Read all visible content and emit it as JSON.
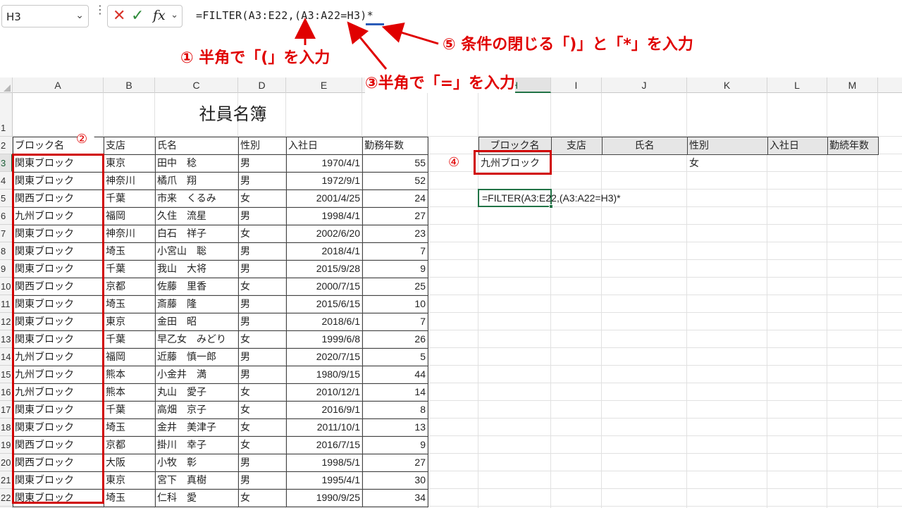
{
  "formula_bar": {
    "name_box": "H3",
    "cancel_glyph": "✕",
    "enter_glyph": "✓",
    "fx_label": "fx",
    "formula": "=FILTER(A3:E22,(A3:A22=H3)*"
  },
  "annotations": {
    "a1": "① 半角で「(」を入力",
    "a2": "②",
    "a3": "③半角で「=」を入力",
    "a4": "④",
    "a5": "⑤ 条件の閉じる「)」と「*」を入力"
  },
  "columns": [
    "A",
    "B",
    "C",
    "D",
    "E",
    "F",
    "G",
    "H",
    "I",
    "J",
    "K",
    "L",
    "M"
  ],
  "rows": [
    "1",
    "2",
    "3",
    "4",
    "5",
    "6",
    "7",
    "8",
    "9",
    "10",
    "11",
    "12",
    "13",
    "14",
    "15",
    "16",
    "17",
    "18",
    "19",
    "20",
    "21",
    "22"
  ],
  "sheet": {
    "title": "社員名簿",
    "headers": [
      "ブロック名",
      "支店",
      "氏名",
      "性別",
      "入社日",
      "勤務年数"
    ],
    "records": [
      [
        "関東ブロック",
        "東京",
        "田中　稔",
        "男",
        "1970/4/1",
        "55"
      ],
      [
        "関東ブロック",
        "神奈川",
        "橘爪　翔",
        "男",
        "1972/9/1",
        "52"
      ],
      [
        "関西ブロック",
        "千葉",
        "市来　くるみ",
        "女",
        "2001/4/25",
        "24"
      ],
      [
        "九州ブロック",
        "福岡",
        "久住　流星",
        "男",
        "1998/4/1",
        "27"
      ],
      [
        "関東ブロック",
        "神奈川",
        "白石　祥子",
        "女",
        "2002/6/20",
        "23"
      ],
      [
        "関東ブロック",
        "埼玉",
        "小宮山　聡",
        "男",
        "2018/4/1",
        "7"
      ],
      [
        "関東ブロック",
        "千葉",
        "我山　大将",
        "男",
        "2015/9/28",
        "9"
      ],
      [
        "関西ブロック",
        "京都",
        "佐藤　里香",
        "女",
        "2000/7/15",
        "25"
      ],
      [
        "関東ブロック",
        "埼玉",
        "斎藤　隆",
        "男",
        "2015/6/15",
        "10"
      ],
      [
        "関東ブロック",
        "東京",
        "金田　昭",
        "男",
        "2018/6/1",
        "7"
      ],
      [
        "関東ブロック",
        "千葉",
        "早乙女　みどり",
        "女",
        "1999/6/8",
        "26"
      ],
      [
        "九州ブロック",
        "福岡",
        "近藤　慎一郎",
        "男",
        "2020/7/15",
        "5"
      ],
      [
        "九州ブロック",
        "熊本",
        "小金井　満",
        "男",
        "1980/9/15",
        "44"
      ],
      [
        "九州ブロック",
        "熊本",
        "丸山　愛子",
        "女",
        "2010/12/1",
        "14"
      ],
      [
        "関東ブロック",
        "千葉",
        "高畑　京子",
        "女",
        "2016/9/1",
        "8"
      ],
      [
        "関東ブロック",
        "埼玉",
        "金井　美津子",
        "女",
        "2011/10/1",
        "13"
      ],
      [
        "関西ブロック",
        "京都",
        "掛川　幸子",
        "女",
        "2016/7/15",
        "9"
      ],
      [
        "関西ブロック",
        "大阪",
        "小牧　彰",
        "男",
        "1998/5/1",
        "27"
      ],
      [
        "関東ブロック",
        "東京",
        "宮下　真樹",
        "男",
        "1995/4/1",
        "30"
      ],
      [
        "関東ブロック",
        "埼玉",
        "仁科　愛",
        "女",
        "1990/9/25",
        "34"
      ]
    ]
  },
  "filter_area": {
    "headers": [
      "ブロック名",
      "支店",
      "氏名",
      "性別",
      "入社日",
      "勤続年数"
    ],
    "cond_block": "九州ブロック",
    "cond_gender": "女",
    "editing_formula": "=FILTER(A3:E22,(A3:A22=H3)*"
  },
  "colors": {
    "accent_red": "#e00000",
    "excel_green": "#217346"
  }
}
